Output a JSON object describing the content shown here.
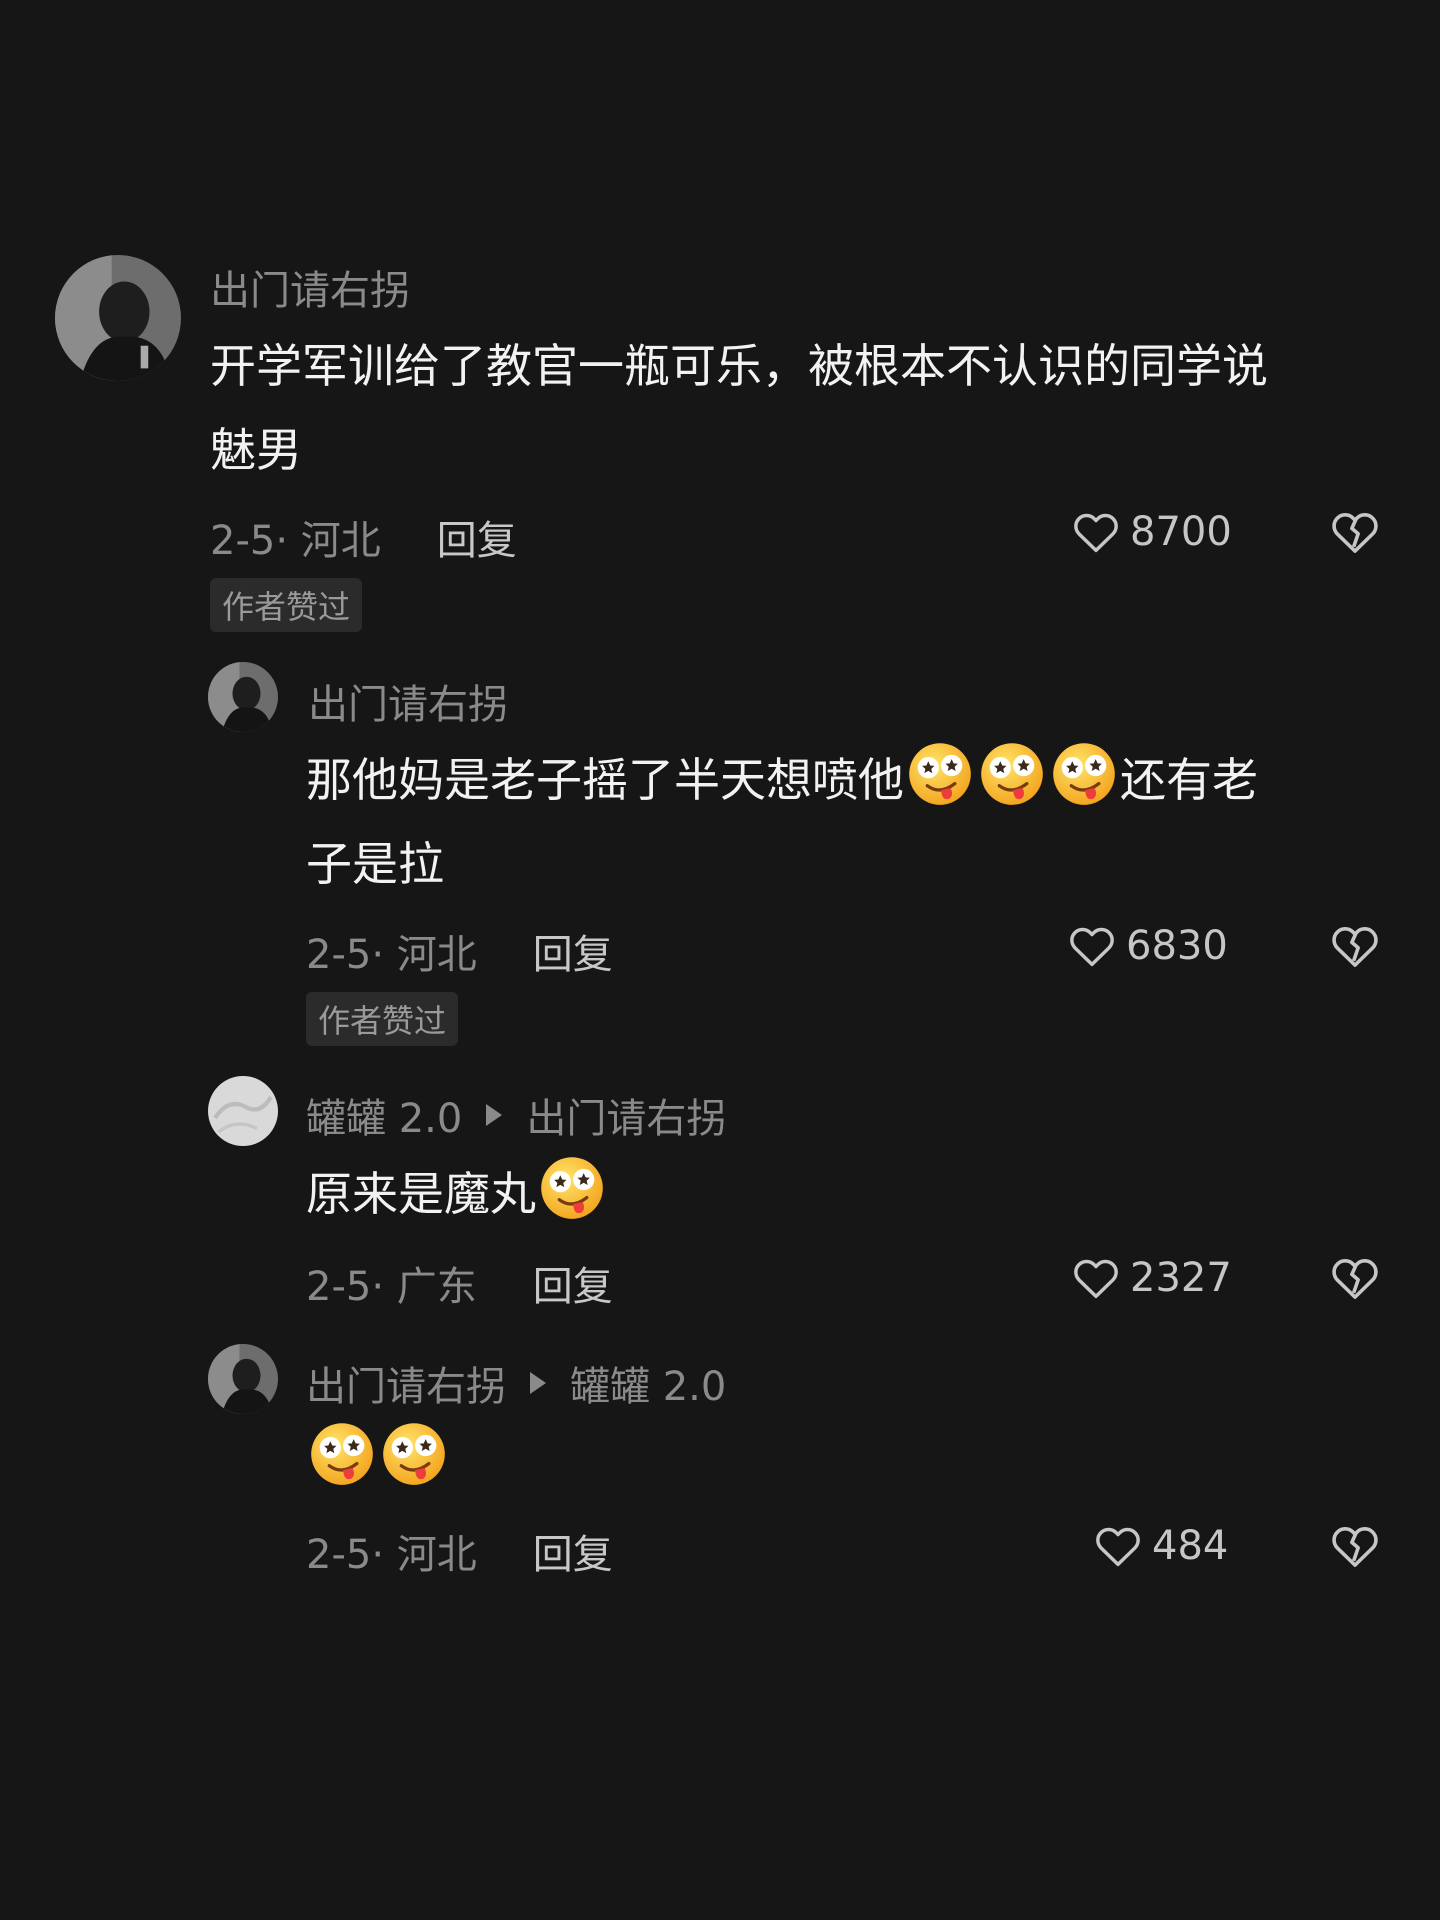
{
  "comments": [
    {
      "author": "出门请右拐",
      "text_line1": "开学军训给了教官一瓶可乐，被根本不认识的同学说",
      "text_line2": "魅男",
      "date_location": "2-5· 河北",
      "reply_label": "回复",
      "likes": "8700",
      "badge": "作者赞过"
    },
    {
      "author": "出门请右拐",
      "text_line1_before": "那他妈是老子摇了半天想喷他",
      "text_line1_after": "还有老",
      "text_line2": "子是拉",
      "date_location": "2-5· 河北",
      "reply_label": "回复",
      "likes": "6830",
      "badge": "作者赞过"
    },
    {
      "author": "罐罐 2.0",
      "reply_to": "出门请右拐",
      "text": "原来是魔丸",
      "date_location": "2-5· 广东",
      "reply_label": "回复",
      "likes": "2327"
    },
    {
      "author": "出门请右拐",
      "reply_to": "罐罐 2.0",
      "date_location": "2-5· 河北",
      "reply_label": "回复",
      "likes": "484"
    }
  ],
  "icons": {
    "like": "heart-outline-icon",
    "dislike": "broken-heart-icon",
    "reply_arrow": "triangle-right-icon",
    "emoji": "drooling-star-eyes-emoji"
  },
  "colors": {
    "background": "#161616",
    "text": "#f2f2f2",
    "muted": "#8a8a8a"
  }
}
